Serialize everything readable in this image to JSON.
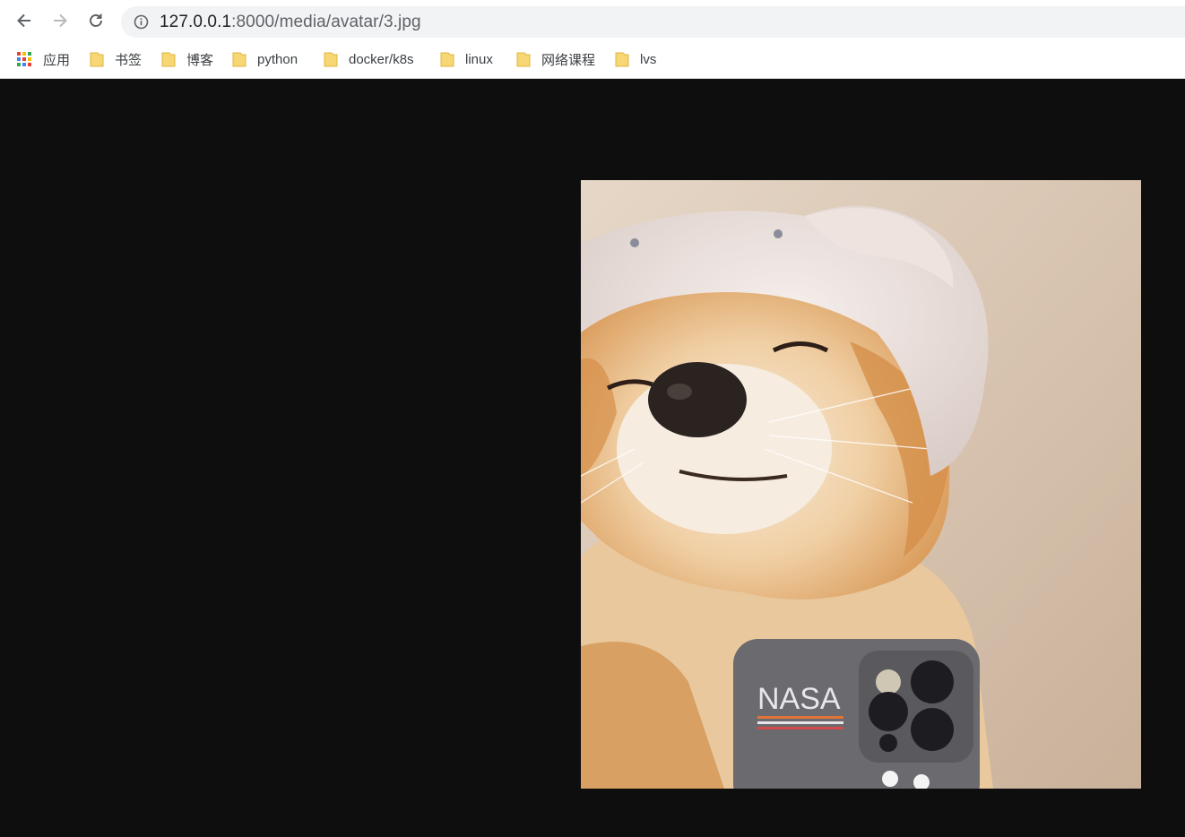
{
  "browser": {
    "url_host": "127.0.0.1",
    "url_path": ":8000/media/avatar/3.jpg",
    "nav": {
      "back_icon": "arrow-left-icon",
      "forward_icon": "arrow-right-icon",
      "reload_icon": "reload-icon",
      "site_info_icon": "info-circle-icon"
    }
  },
  "bookmarks": {
    "apps_label": "应用",
    "items": [
      {
        "label": "书签"
      },
      {
        "label": "博客"
      },
      {
        "label": "python"
      },
      {
        "label": "docker/k8s"
      },
      {
        "label": "linux"
      },
      {
        "label": "网络课程"
      },
      {
        "label": "lvs"
      }
    ]
  },
  "image": {
    "description_icon": "shiba-dog-photo",
    "phone_case_text": "NASA"
  },
  "colors": {
    "page_background": "#0e0e0e",
    "omnibox_background": "#f1f3f4",
    "folder_yellow": "#f7d774"
  }
}
